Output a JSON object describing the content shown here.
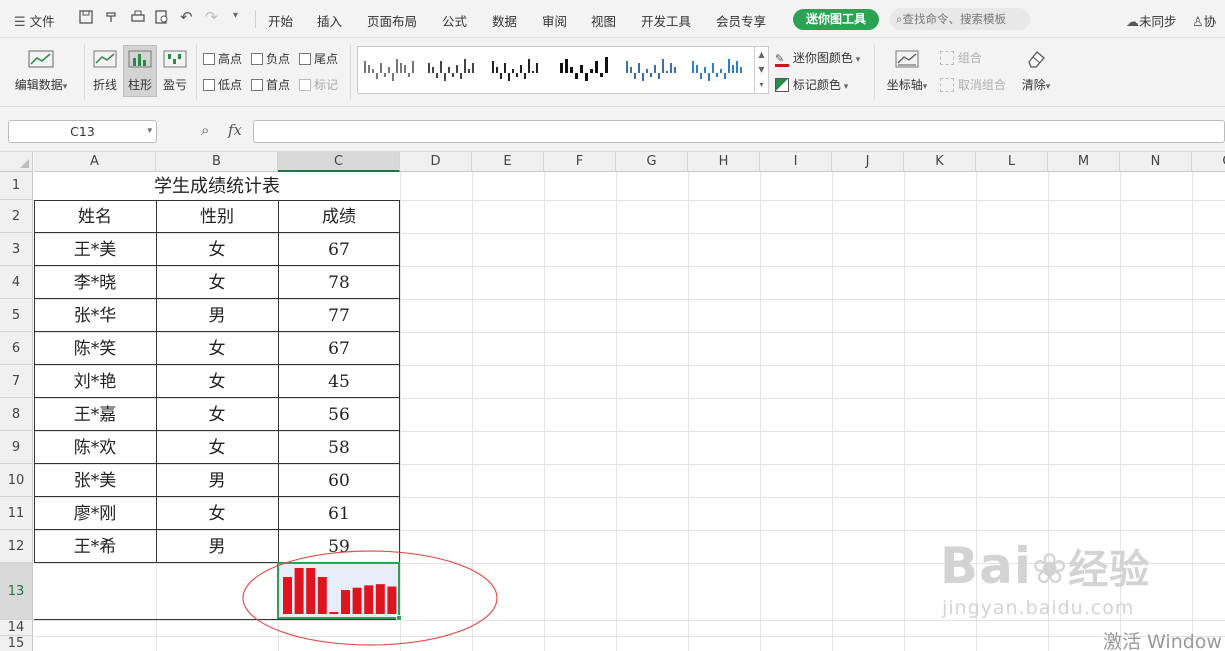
{
  "menubar": {
    "file_label": "文件",
    "tabs": [
      "开始",
      "插入",
      "页面布局",
      "公式",
      "数据",
      "审阅",
      "视图",
      "开发工具",
      "会员专享"
    ],
    "active_tab": "迷你图工具",
    "search_placeholder": "查找命令、搜索模板",
    "sync_label": "未同步",
    "collab_label": "协"
  },
  "ribbon": {
    "edit_data": "编辑数据",
    "line": "折线",
    "column": "柱形",
    "winloss": "盈亏",
    "checks": {
      "high": "高点",
      "negative": "负点",
      "last": "尾点",
      "low": "低点",
      "first": "首点",
      "marker": "标记"
    },
    "sparkline_color": "迷你图颜色",
    "marker_color": "标记颜色",
    "axis": "坐标轴",
    "group": "组合",
    "ungroup": "取消组合",
    "clear": "清除"
  },
  "formula": {
    "namebox": "C13",
    "fx": "fx",
    "value": ""
  },
  "columns": [
    "A",
    "B",
    "C",
    "D",
    "E",
    "F",
    "G",
    "H",
    "I",
    "J",
    "K",
    "L",
    "M",
    "N",
    "O"
  ],
  "rows": [
    "1",
    "2",
    "3",
    "4",
    "5",
    "6",
    "7",
    "8",
    "9",
    "10",
    "11",
    "12",
    "13",
    "14",
    "15"
  ],
  "sheet": {
    "title": "学生成绩统计表",
    "headers": [
      "姓名",
      "性别",
      "成绩"
    ],
    "records": [
      [
        "王*美",
        "女",
        "67"
      ],
      [
        "李*晓",
        "女",
        "78"
      ],
      [
        "张*华",
        "男",
        "77"
      ],
      [
        "陈*笑",
        "女",
        "67"
      ],
      [
        "刘*艳",
        "女",
        "45"
      ],
      [
        "王*嘉",
        "女",
        "56"
      ],
      [
        "陈*欢",
        "女",
        "58"
      ],
      [
        "张*美",
        "男",
        "60"
      ],
      [
        "廖*刚",
        "女",
        "61"
      ],
      [
        "王*希",
        "男",
        "59"
      ]
    ]
  },
  "sparkline": {
    "cell": "C13",
    "type": "column",
    "color": "#e0141e",
    "values": [
      67,
      78,
      77,
      67,
      45,
      56,
      58,
      60,
      61,
      59
    ]
  },
  "watermark": {
    "brand": "Bai",
    "brand_tail": "经验",
    "url": "jingyan.baidu.com"
  },
  "activation": "激活 Window"
}
